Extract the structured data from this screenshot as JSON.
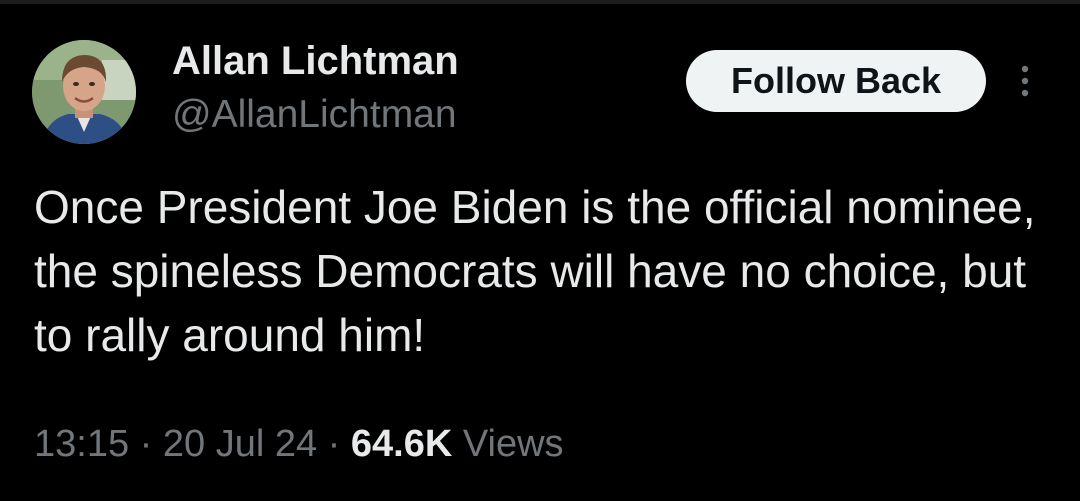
{
  "author": {
    "display_name": "Allan Lichtman",
    "handle": "@AllanLichtman",
    "avatar_icon": "profile-photo"
  },
  "actions": {
    "follow_label": "Follow Back",
    "more_icon": "vertical-dots-icon"
  },
  "tweet": {
    "text": "Once President Joe Biden is the official nominee, the spineless Democrats will have no choice, but to rally around him!"
  },
  "meta": {
    "time": "13:15",
    "separator": " · ",
    "date": "20 Jul 24",
    "views_count": "64.6K",
    "views_label": "Views"
  },
  "colors": {
    "background": "#000000",
    "primary_text": "#e7e9ea",
    "secondary_text": "#71767b",
    "button_bg": "#eff3f4",
    "button_text": "#0f1419"
  }
}
